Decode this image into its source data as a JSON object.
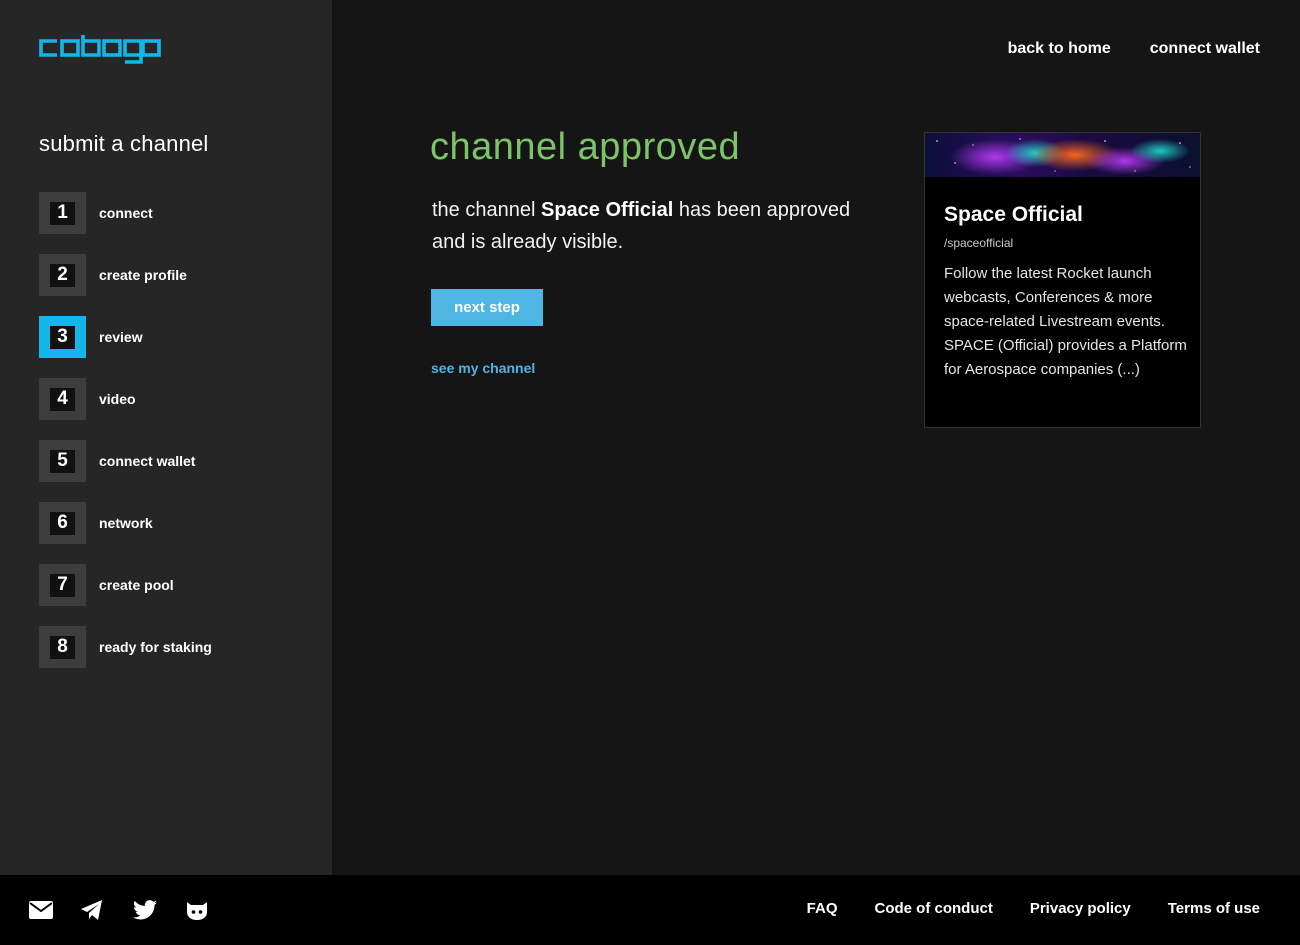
{
  "brand": {
    "logo_text": "cobogo",
    "accent": "#13b6e8"
  },
  "nav": {
    "back_home": "back to home",
    "connect_wallet": "connect wallet"
  },
  "sidebar": {
    "title": "submit a channel",
    "active_step": 3,
    "steps": [
      {
        "num": "1",
        "label": "connect"
      },
      {
        "num": "2",
        "label": "create profile"
      },
      {
        "num": "3",
        "label": "review"
      },
      {
        "num": "4",
        "label": "video"
      },
      {
        "num": "5",
        "label": "connect wallet"
      },
      {
        "num": "6",
        "label": "network"
      },
      {
        "num": "7",
        "label": "create pool"
      },
      {
        "num": "8",
        "label": "ready for staking"
      }
    ]
  },
  "main": {
    "heading": "channel approved",
    "message_prefix": "the channel ",
    "channel_name": "Space Official",
    "message_suffix": " has been approved and is already visible.",
    "next_button": "next step",
    "see_channel_link": "see my channel",
    "heading_color": "#7cc36a"
  },
  "card": {
    "title": "Space Official",
    "handle": "/spaceofficial",
    "description": "Follow the latest Rocket launch webcasts, Conferences & more space-related Livestream events. SPACE (Official) provides a Platform for Aerospace companies (...)"
  },
  "footer": {
    "social_icons": [
      "mail-icon",
      "telegram-icon",
      "twitter-icon",
      "github-icon"
    ],
    "links": [
      "FAQ",
      "Code of conduct",
      "Privacy policy",
      "Terms of use"
    ]
  }
}
